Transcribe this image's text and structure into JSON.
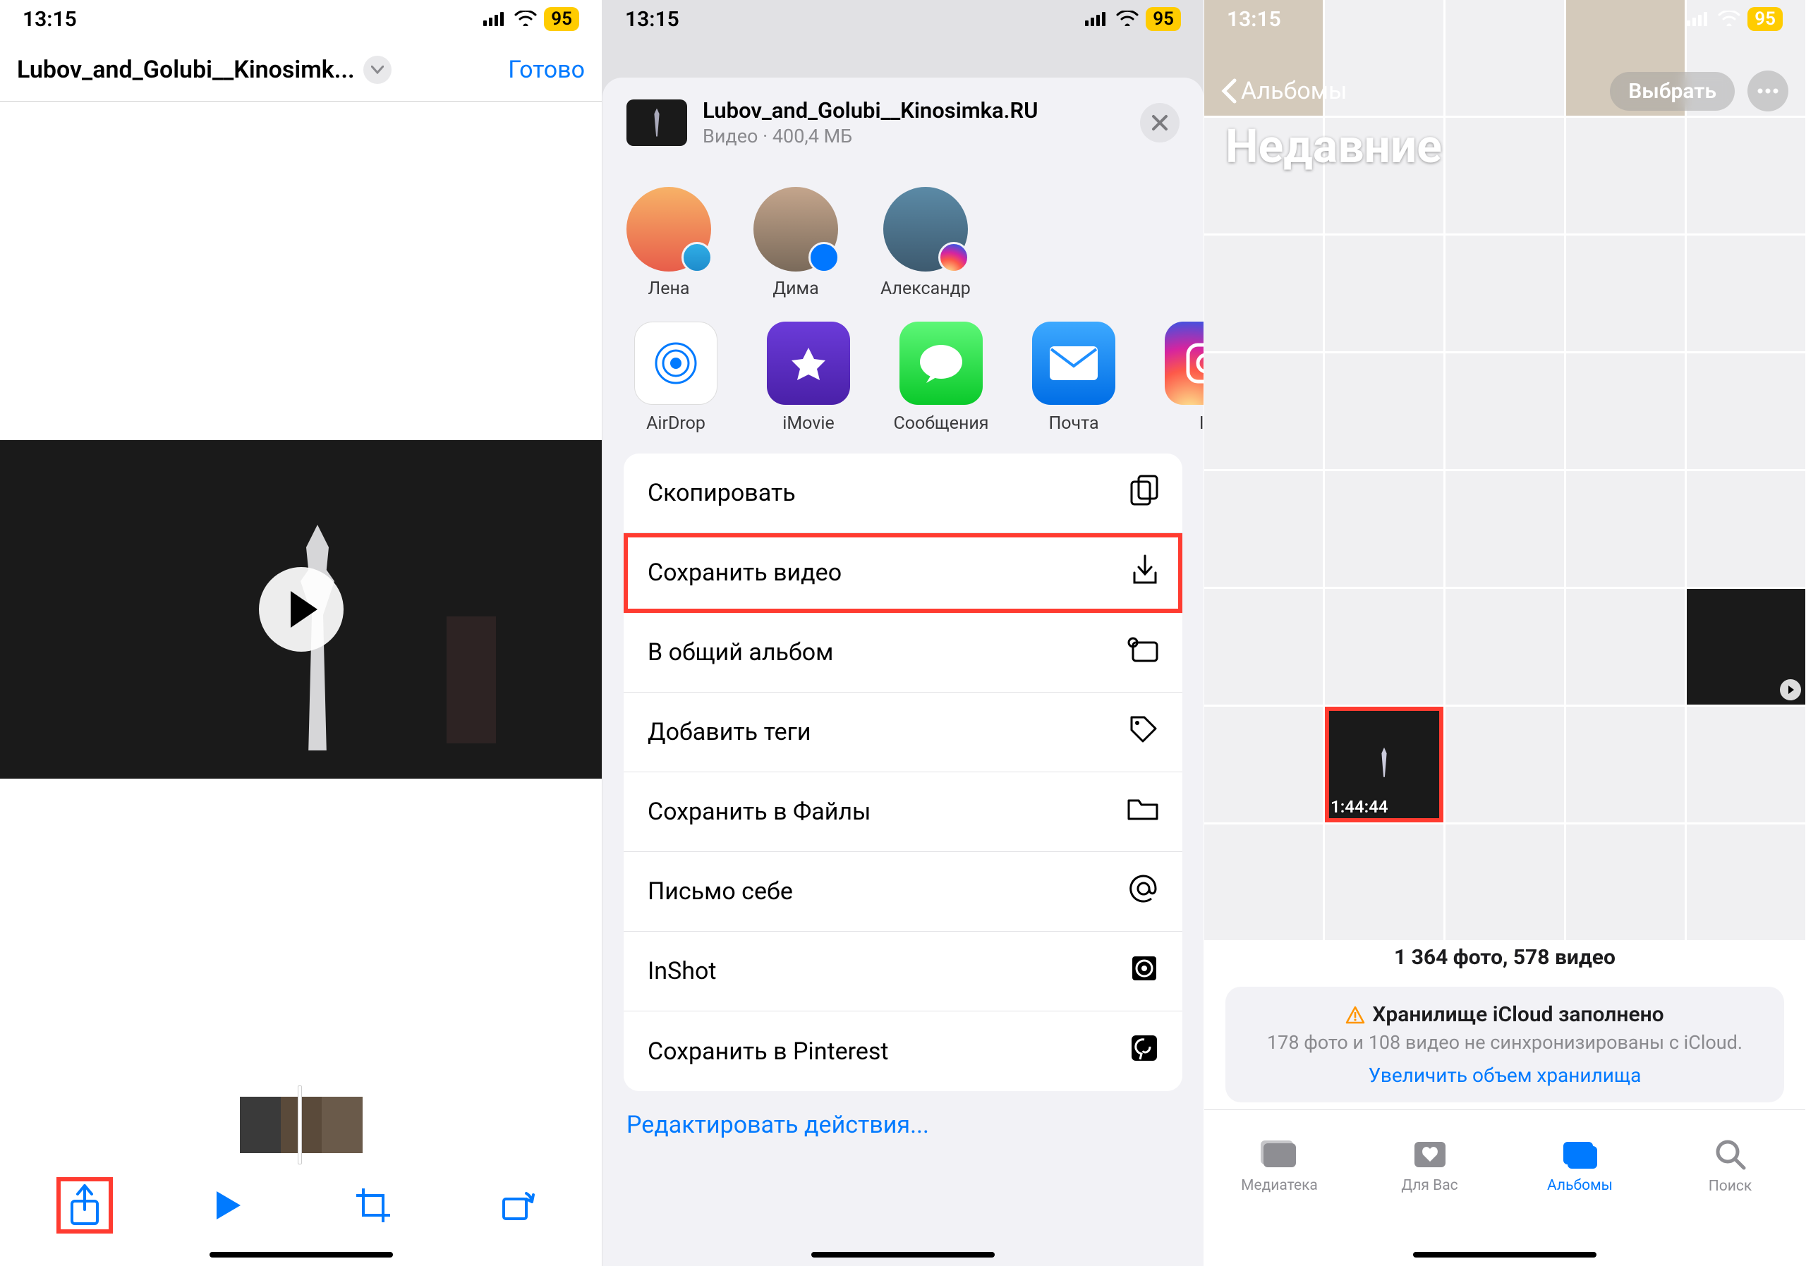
{
  "status": {
    "time": "13:15",
    "battery": "95"
  },
  "screen1": {
    "title": "Lubov_and_Golubi__Kinosimk...",
    "done": "Готово"
  },
  "screen2": {
    "sheet_title": "Lubov_and_Golubi__Kinosimka.RU",
    "sheet_sub": "Видео · 400,4 МБ",
    "contacts": [
      {
        "name": "Лена",
        "badge": "badge-tg"
      },
      {
        "name": "Дима",
        "badge": "badge-vk"
      },
      {
        "name": "Александр",
        "badge": "badge-ig"
      }
    ],
    "apps": [
      {
        "name": "AirDrop",
        "cls": "app-airdrop"
      },
      {
        "name": "iMovie",
        "cls": "app-imovie"
      },
      {
        "name": "Сообщения",
        "cls": "app-msg"
      },
      {
        "name": "Почта",
        "cls": "app-mail"
      },
      {
        "name": "In",
        "cls": "app-ig"
      }
    ],
    "actions": [
      {
        "label": "Скопировать",
        "icon": "copy-icon"
      },
      {
        "label": "Сохранить видео",
        "icon": "download-icon",
        "highlight": true
      },
      {
        "label": "В общий альбом",
        "icon": "shared-album-icon"
      },
      {
        "label": "Добавить теги",
        "icon": "tag-icon"
      },
      {
        "label": "Сохранить в Файлы",
        "icon": "folder-icon"
      },
      {
        "label": "Письмо себе",
        "icon": "at-icon"
      },
      {
        "label": "InShot",
        "icon": "inshot-icon"
      },
      {
        "label": "Сохранить в Pinterest",
        "icon": "pinterest-icon"
      }
    ],
    "edit_actions": "Редактировать действия..."
  },
  "screen3": {
    "back": "Альбомы",
    "select": "Выбрать",
    "collection_title": "Недавние",
    "video_duration": "1:44:44",
    "summary": "1 364 фото, 578 видео",
    "alert_title": "Хранилище iCloud заполнено",
    "alert_sub": "178 фото и 108 видео не синхронизированы с iCloud.",
    "alert_link": "Увеличить объем хранилища",
    "tabs": [
      {
        "label": "Медиатека",
        "icon": "library-icon"
      },
      {
        "label": "Для Вас",
        "icon": "for-you-icon"
      },
      {
        "label": "Альбомы",
        "icon": "albums-icon",
        "active": true
      },
      {
        "label": "Поиск",
        "icon": "search-icon"
      }
    ]
  }
}
